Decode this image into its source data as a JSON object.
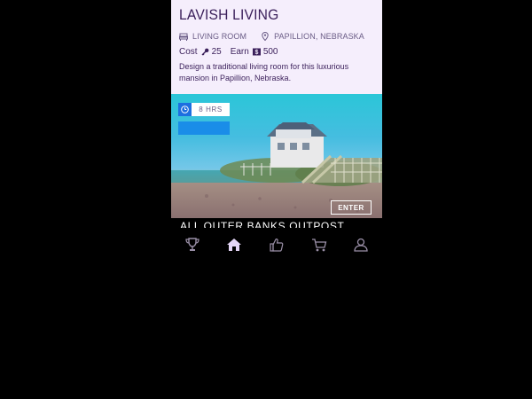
{
  "card": {
    "title": "LAVISH LIVING",
    "room_type": "LIVING ROOM",
    "location": "PAPILLION, NEBRASKA",
    "cost_label": "Cost",
    "cost_value": "25",
    "earn_label": "Earn",
    "earn_value": "500",
    "description": "Design a traditional living room for this luxurious mansion in Papillion, Nebraska.",
    "duration": "8 HRS",
    "enter_label": "ENTER"
  },
  "next_card": {
    "title": "ALL OUTER BANKS OUTPOST"
  },
  "nav": {
    "items": [
      {
        "icon": "trophy-icon"
      },
      {
        "icon": "home-icon",
        "active": true
      },
      {
        "icon": "thumbs-up-icon"
      },
      {
        "icon": "cart-icon"
      },
      {
        "icon": "profile-icon"
      }
    ]
  },
  "colors": {
    "card_bg": "#f5eefc",
    "title": "#3a1f5a",
    "accent_blue": "#1a8de8",
    "nav_active": "#e4d6f6",
    "nav_inactive": "#9b90a8"
  }
}
